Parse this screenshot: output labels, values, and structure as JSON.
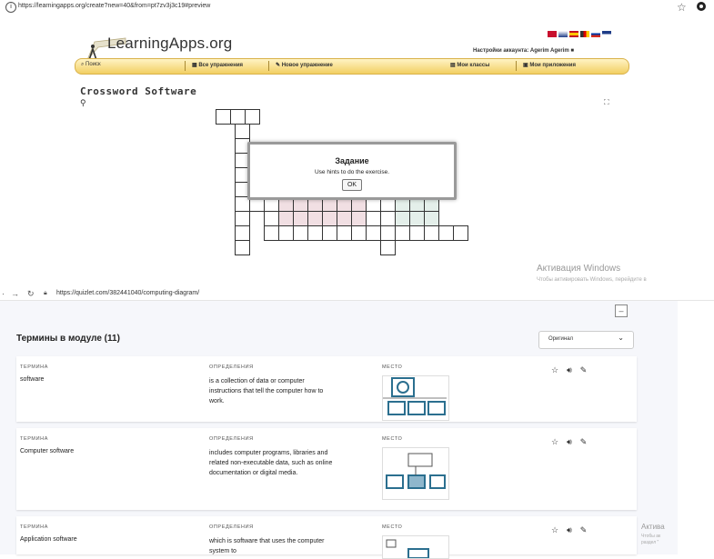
{
  "top_browser": {
    "url": "https://learningapps.org/create?new=40&from=pt7zv3j3c19#preview",
    "star_icon": "star-icon"
  },
  "learningapps": {
    "logo": "LearningApps.org",
    "user_settings": "Настройки аккаунта: Agerim Agerim",
    "menu": {
      "search": "Поиск",
      "all_exercises": "Все упражнения",
      "new_exercise": "Новое упражнение",
      "my_classes": "Мои классы",
      "my_apps": "Мои приложения"
    },
    "exercise_title": "Crossword Software",
    "dialog": {
      "title": "Задание",
      "message": "Use hints to do the exercise.",
      "ok": "OK"
    }
  },
  "windows_activation": {
    "title": "Активация Windows",
    "subtitle": "Чтобы активировать Windows, перейдите в",
    "title_short": "Актива",
    "subtitle_short": "Чтобы ак",
    "subtitle_short2": "раздел \""
  },
  "bottom_browser": {
    "url": "https://quizlet.com/382441040/computing-diagram/"
  },
  "quizlet": {
    "terms_title": "Термины в модуле (11)",
    "sort_select": "Оригинал",
    "headers": {
      "term": "ТЕРМИНА",
      "definition": "ОПРЕДЕЛЕНИЯ",
      "place": "МЕСТО"
    },
    "cards": [
      {
        "term": "software",
        "definition": "is a collection of data or computer instructions that tell the computer how to work."
      },
      {
        "term": "Computer software",
        "definition": "includes computer programs, libraries and related non-executable data, such as online documentation or digital media."
      },
      {
        "term": "Application software",
        "definition": "which is software that uses the computer system to"
      }
    ]
  },
  "colors": {
    "menu_bar": "#f2cf63",
    "shaded_cell": "#f1dfe3",
    "green_cell": "#e4efea"
  }
}
